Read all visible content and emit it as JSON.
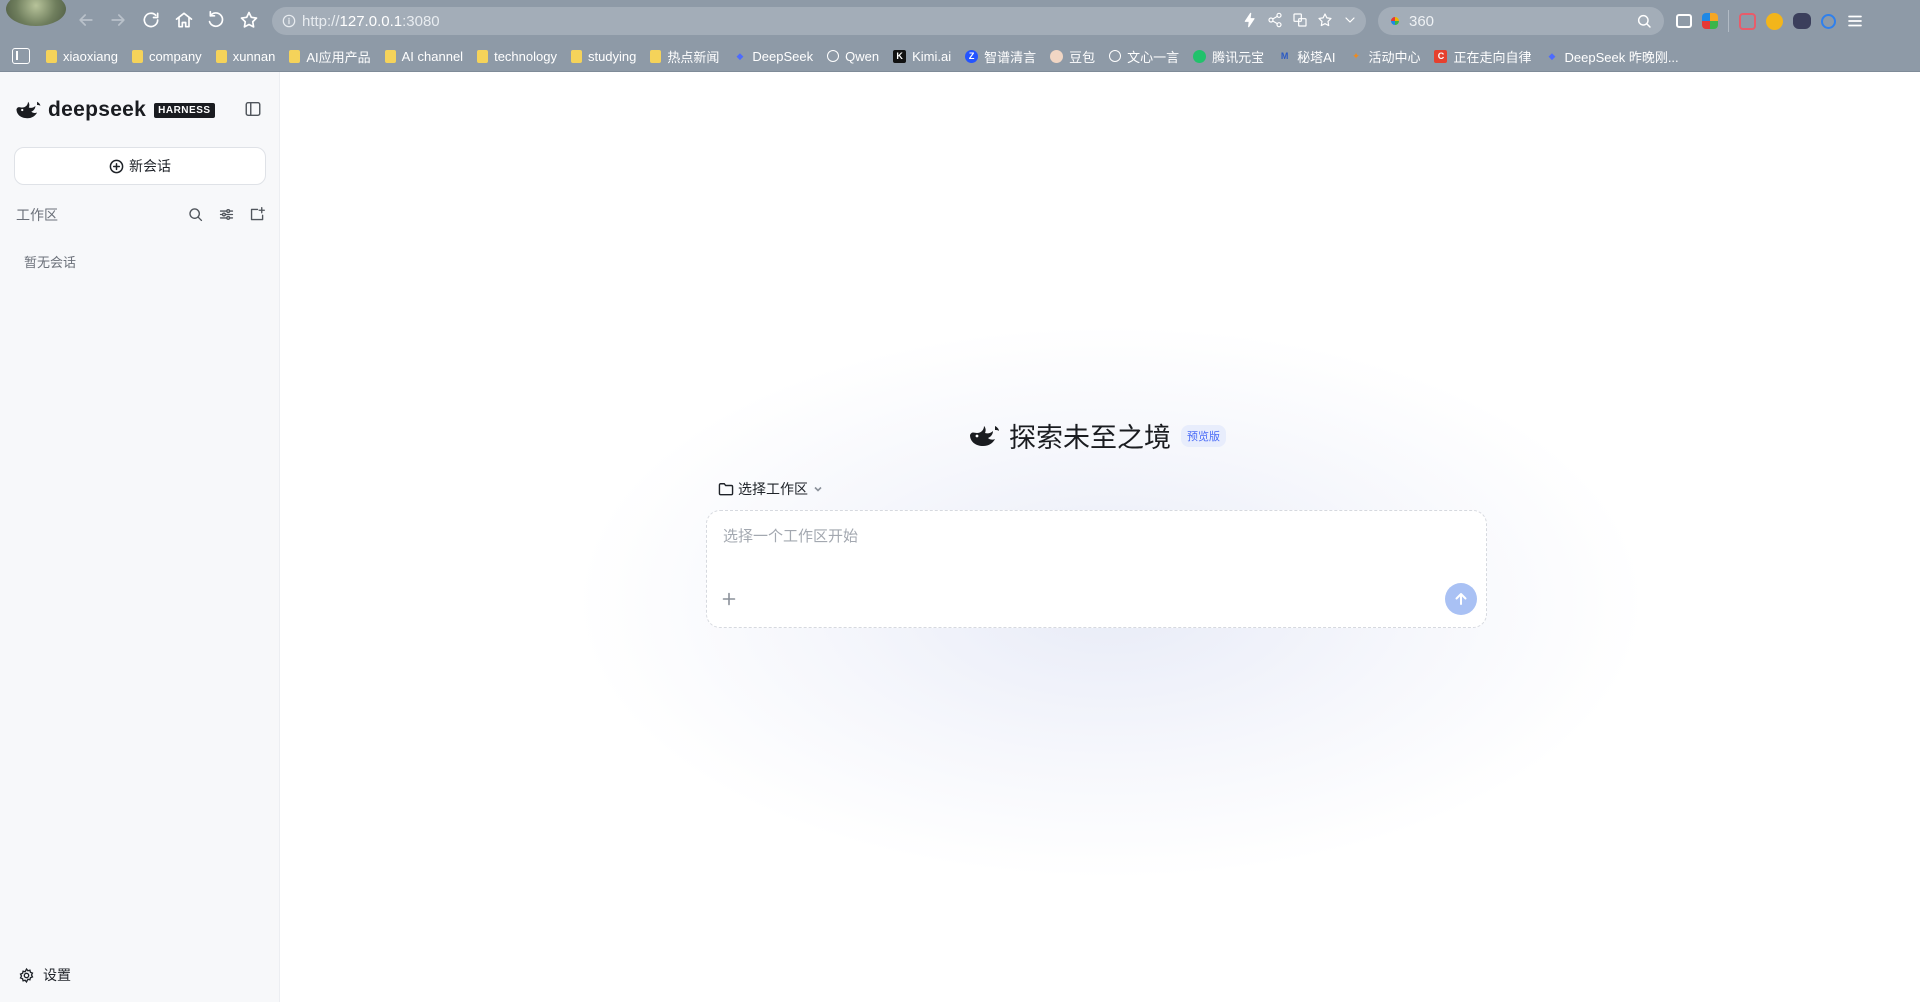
{
  "browser": {
    "url_prefix": "http://",
    "url_host": "127.0.0.1",
    "url_port": ":3080",
    "search_text": "360"
  },
  "bookmarks": [
    {
      "label": "xiaoxiang",
      "icon": "folder-icon"
    },
    {
      "label": "company",
      "icon": "folder-icon"
    },
    {
      "label": "xunnan",
      "icon": "folder-icon"
    },
    {
      "label": "AI应用产品",
      "icon": "folder-icon"
    },
    {
      "label": "AI channel",
      "icon": "folder-icon"
    },
    {
      "label": "technology",
      "icon": "folder-icon"
    },
    {
      "label": "studying",
      "icon": "folder-icon"
    },
    {
      "label": "热点新闻",
      "icon": "folder-icon"
    },
    {
      "label": "DeepSeek",
      "icon": "deepseek-icon"
    },
    {
      "label": "Qwen",
      "icon": "qwen-icon"
    },
    {
      "label": "Kimi.ai",
      "icon": "kimi-icon"
    },
    {
      "label": "智谱清言",
      "icon": "zhipu-icon"
    },
    {
      "label": "豆包",
      "icon": "doubao-icon"
    },
    {
      "label": "文心一言",
      "icon": "wenxin-icon"
    },
    {
      "label": "腾讯元宝",
      "icon": "yuanbao-icon"
    },
    {
      "label": "秘塔AI",
      "icon": "metaso-icon"
    },
    {
      "label": "活动中心",
      "icon": "activity-icon"
    },
    {
      "label": "正在走向自律",
      "icon": "c-icon"
    },
    {
      "label": "DeepSeek 昨晚刚...",
      "icon": "deepseek-icon"
    }
  ],
  "sidebar": {
    "brand_name": "deepseek",
    "brand_badge": "HARNESS",
    "new_chat_label": "新会话",
    "workspace_title": "工作区",
    "empty_text": "暂无会话",
    "settings_label": "设置"
  },
  "main": {
    "hero_title": "探索未至之境",
    "preview_badge": "预览版",
    "workspace_selector": "选择工作区",
    "composer_placeholder": "选择一个工作区开始"
  },
  "colors": {
    "browser_chrome": "#8e9aa7",
    "sidebar_bg": "#f7f8fa",
    "accent": "#4a6cf7",
    "send_disabled": "#a9c1f4"
  }
}
